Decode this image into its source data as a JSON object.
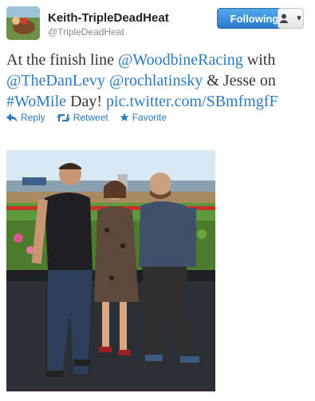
{
  "header": {
    "display_name": "Keith-TripleDeadHeat",
    "screen_name": "@TripleDeadHeat",
    "follow_label": "Following",
    "user_menu_label": "▾"
  },
  "tweet": {
    "text_prefix_1": "At the finish line ",
    "mention_1": "@WoodbineRacing",
    "text_1": " with",
    "mention_2": "@TheDanLevy",
    "space_1": " ",
    "mention_3": "@rochlatinsky",
    "text_2": " & Jesse on",
    "hashtag": "#WoMile",
    "text_3": " Day! ",
    "pic_link": "pic.twitter.com/SBmfmgfF"
  },
  "actions": {
    "reply": "Reply",
    "retweet": "Retweet",
    "favorite": "Favorite"
  },
  "colors": {
    "link": "#2a7bc3",
    "follow_button": "#2b7bc9"
  }
}
